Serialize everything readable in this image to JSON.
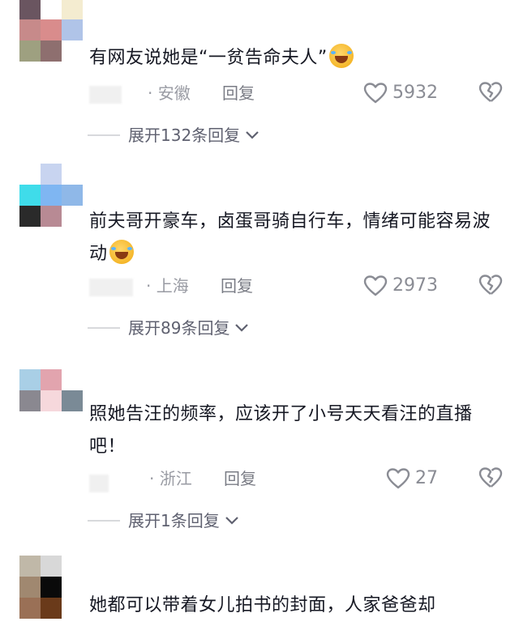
{
  "comments": [
    {
      "text": "有网友说她是“一贫告命夫人”",
      "location": "· 安徽",
      "reply_label": "回复",
      "likes": "5932",
      "expand_label": "展开132条回复",
      "avatar_colors": [
        "#6a5560",
        "#ffffff",
        "#f4ecd0",
        "#c78a8a",
        "#d98c8c",
        "#b0c4e8",
        "#9ea080",
        "#8e6f6f",
        "#ffffff"
      ]
    },
    {
      "text": "前夫哥开豪车，卤蛋哥骑自行车，情绪可能容易波动",
      "location": "· 上海",
      "reply_label": "回复",
      "likes": "2973",
      "expand_label": "展开89条回复",
      "avatar_colors": [
        "#ffffff",
        "#c8d4f0",
        "#ffffff",
        "#3fdcea",
        "#7fb6f2",
        "#8fb8e8",
        "#2a2a2a",
        "#b88a94",
        "#ffffff"
      ]
    },
    {
      "text": "照她告汪的频率，应该开了小号天天看汪的直播吧！",
      "location": "· 浙江",
      "reply_label": "回复",
      "likes": "27",
      "expand_label": "展开1条回复",
      "avatar_colors": [
        "#a9cfe6",
        "#e2a4ae",
        "#ffffff",
        "#8a8890",
        "#f6d8dc",
        "#7a8a96",
        "#ffffff",
        "#ffffff",
        "#ffffff"
      ]
    },
    {
      "text": "她都可以带着女儿拍书的封面，人家爸爸却",
      "avatar_colors": [
        "#c0b8a8",
        "#d8d8d8",
        "#ffffff",
        "#a08870",
        "#0a0a0a",
        "#ffffff",
        "#9a7056",
        "#6a3a1a",
        "#ffffff"
      ]
    }
  ],
  "icons": {
    "like": "heart-outline-icon",
    "dislike": "broken-heart-icon",
    "expand": "chevron-down-icon"
  },
  "colors": {
    "text": "#161823",
    "meta": "#999ba3",
    "icon": "#8a8c94"
  }
}
